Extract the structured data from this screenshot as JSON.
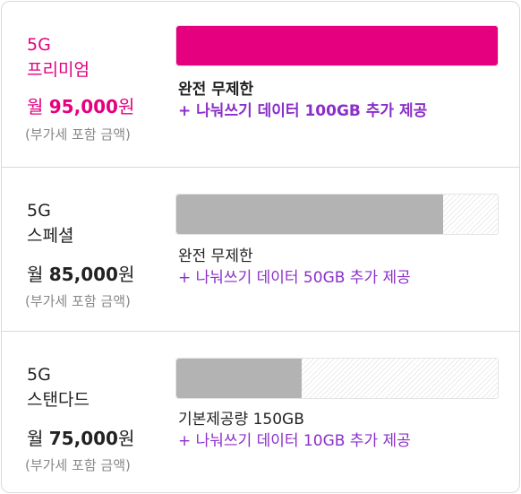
{
  "colors": {
    "accent": "#e4007f",
    "purple": "#8b2fc9",
    "gray_bar": "#b3b3b3"
  },
  "plans": [
    {
      "line1": "5G",
      "line2": "프리미엄",
      "price_prefix": "월 ",
      "price_amount": "95,000",
      "price_suffix": "원",
      "vat_note": "(부가세 포함 금액)",
      "data_fill_fraction": 1.0,
      "main_desc": "완전 무제한",
      "extra_desc": "+ 나눠쓰기 데이터 100GB 추가 제공"
    },
    {
      "line1": "5G",
      "line2": "스페셜",
      "price_prefix": "월 ",
      "price_amount": "85,000",
      "price_suffix": "원",
      "vat_note": "(부가세 포함 금액)",
      "data_fill_fraction": 0.83,
      "main_desc": "완전 무제한",
      "extra_desc": "+ 나눠쓰기 데이터 50GB 추가 제공"
    },
    {
      "line1": "5G",
      "line2": "스탠다드",
      "price_prefix": "월 ",
      "price_amount": "75,000",
      "price_suffix": "원",
      "vat_note": "(부가세 포함 금액)",
      "data_fill_fraction": 0.39,
      "main_desc": "기본제공량 150GB",
      "extra_desc": "+ 나눠쓰기 데이터 10GB 추가 제공"
    }
  ]
}
